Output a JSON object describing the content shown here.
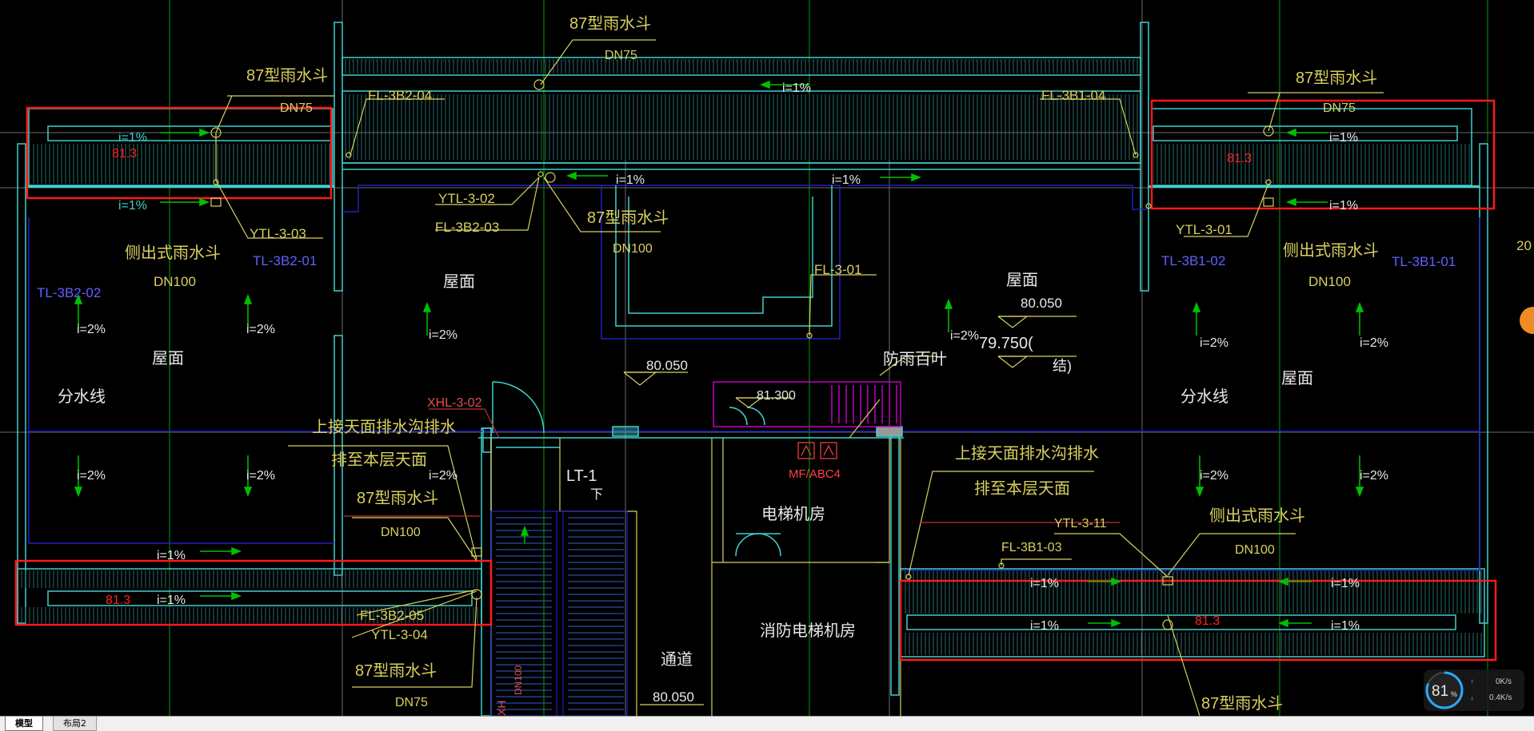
{
  "drawing": {
    "labels": {
      "rain_hopper_87": "87型雨水斗",
      "side_hopper": "侧出式雨水斗",
      "dn75": "DN75",
      "dn100": "DN100",
      "slope_1": "i=1%",
      "slope_2": "i=2%",
      "roof": "屋面",
      "divide_line": "分水线",
      "elev_81_3": "81.3",
      "ytl_3_03": "YTL-3-03",
      "tl_3b2_01": "TL-3B2-01",
      "tl_3b2_02": "TL-3B2-02",
      "fl_3b2_04": "FL-3B2-04",
      "fl_3b1_04": "FL-3B1-04",
      "ytl_3_02": "YTL-3-02",
      "fl_3b2_03": "FL-3B2-03",
      "fl_3_01": "FL-3-01",
      "elev_80_050": "80.050",
      "elev_79_750": "79.750(",
      "struct": "结)",
      "ytl_3_01": "YTL-3-01",
      "tl_3b1_02": "TL-3B1-02",
      "tl_3b1_01": "TL-3B1-01",
      "xhl_3_02": "XHL-3-02",
      "upper_drain_1": "上接天面排水沟排水",
      "upper_drain_2": "排至本层天面",
      "elev_81_300": "81.300",
      "rain_louver": "防雨百叶",
      "mf_abc4": "MF/ABC4",
      "elevator_room": "电梯机房",
      "fire_elevator_room": "消防电梯机房",
      "passage": "通道",
      "lt1": "LT-1",
      "down": "下",
      "fl_3b2_05": "FL-3B2-05",
      "ytl_3_04": "YTL-3-04",
      "ytl_3_11": "YTL-3-11",
      "fl_3b1_03": "FL-3B1-03",
      "xh": "XH",
      "dn100_vert": "DN100",
      "edge_20": "20"
    }
  },
  "tabs": [
    {
      "label": "模型",
      "active": true
    },
    {
      "label": "布局2",
      "active": false
    }
  ],
  "netmon": {
    "percent": "81",
    "percent_unit": "%",
    "up_speed": "0K/s",
    "down_speed": "0.4K/s"
  },
  "colors": {
    "background": "#000000",
    "cyan": "#3fd0d0",
    "yellow": "#d8d060",
    "red": "#ff0000",
    "blue": "#2020c0",
    "green": "#00c000",
    "white": "#e8e8e8",
    "magenta": "#c000c0",
    "grid": "#8a8a8a"
  }
}
